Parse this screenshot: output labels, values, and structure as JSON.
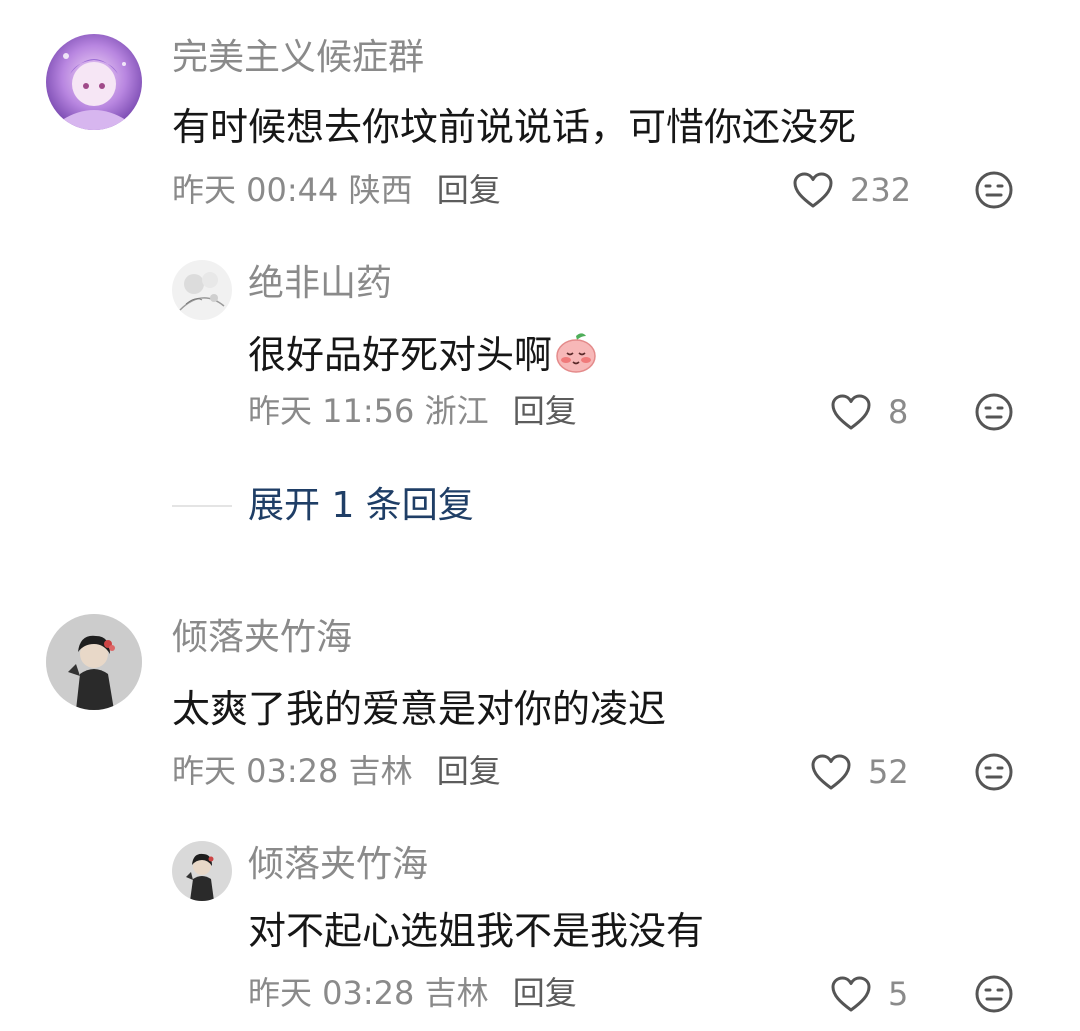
{
  "comments": [
    {
      "username": "完美主义候症群",
      "text": "有时候想去你坟前说说话，可惜你还没死",
      "time": "昨天 00:44",
      "location": "陕西",
      "reply_label": "回复",
      "likes": "232",
      "replies": [
        {
          "username": "绝非山药",
          "text": "很好品好死对头啊",
          "time": "昨天 11:56",
          "location": "浙江",
          "reply_label": "回复",
          "likes": "8"
        }
      ],
      "expand_label": "展开 1 条回复"
    },
    {
      "username": "倾落夹竹海",
      "text": "太爽了我的爱意是对你的凌迟",
      "time": "昨天 03:28",
      "location": "吉林",
      "reply_label": "回复",
      "likes": "52",
      "replies": [
        {
          "username": "倾落夹竹海",
          "text": "对不起心选姐我不是我没有",
          "time": "昨天 03:28",
          "location": "吉林",
          "reply_label": "回复",
          "likes": "5"
        }
      ]
    }
  ],
  "icons": {
    "like": "heart-outline-icon",
    "dislike": "meh-face-icon",
    "emoji": "shy-peach-emoji"
  },
  "colors": {
    "username": "#8a8a8a",
    "text": "#161616",
    "expand_link": "#1f3e66"
  }
}
